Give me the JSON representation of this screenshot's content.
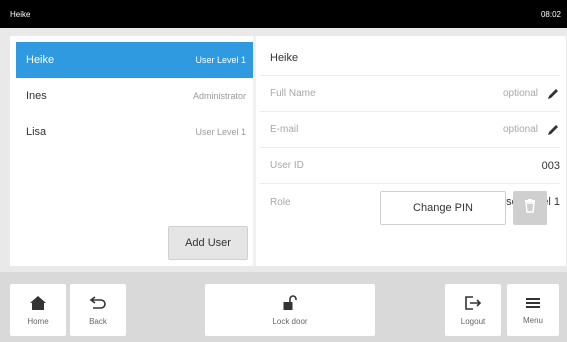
{
  "statusbar": {
    "title": "Heike",
    "time": "08:02"
  },
  "users": [
    {
      "name": "Heike",
      "role": "User Level 1",
      "selected": true
    },
    {
      "name": "Ines",
      "role": "Administrator",
      "selected": false
    },
    {
      "name": "Lisa",
      "role": "User Level 1",
      "selected": false
    }
  ],
  "add_user_label": "Add User",
  "details": {
    "name": "Heike",
    "full_name_label": "Full Name",
    "full_name_value": "optional",
    "email_label": "E-mail",
    "email_value": "optional",
    "user_id_label": "User ID",
    "user_id_value": "003",
    "role_label": "Role",
    "role_value": "User Level 1"
  },
  "change_pin_label": "Change PIN",
  "nav": {
    "home": "Home",
    "back": "Back",
    "lock": "Lock door",
    "logout": "Logout",
    "menu": "Menu"
  },
  "colors": {
    "accent": "#2f9ae0",
    "statusbar": "#000000"
  }
}
